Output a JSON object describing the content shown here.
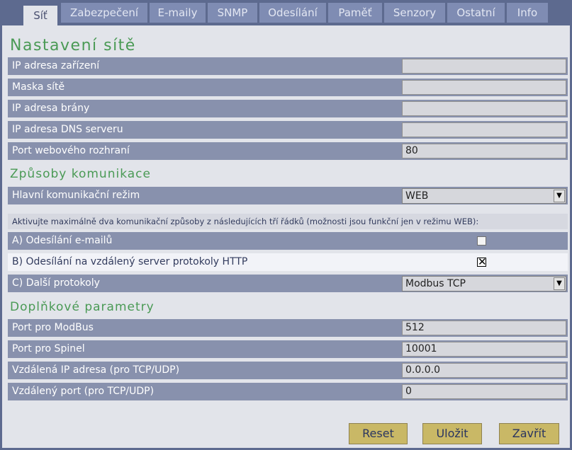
{
  "tabs": [
    "Síť",
    "Zabezpečení",
    "E-maily",
    "SNMP",
    "Odesílání",
    "Paměť",
    "Senzory",
    "Ostatní",
    "Info"
  ],
  "page_title": "Nastavení sítě",
  "network": {
    "ip_label": "IP adresa zařízení",
    "ip_value": "",
    "mask_label": "Maska sítě",
    "mask_value": "",
    "gateway_label": "IP adresa brány",
    "gateway_value": "",
    "dns_label": "IP adresa DNS serveru",
    "dns_value": "",
    "port_label": "Port webového rozhraní",
    "port_value": "80"
  },
  "communication": {
    "section_title": "Způsoby komunikace",
    "mode_label": "Hlavní komunikační režim",
    "mode_value": "WEB",
    "note": "Aktivujte maximálně dva komunikační způsoby z následujících tří řádků (možnosti jsou funkční jen v režimu WEB):",
    "email_label": "A) Odesílání e-mailů",
    "email_checked": false,
    "http_label": "B) Odesílání na vzdálený server protokoly HTTP",
    "http_checked": true,
    "http_mark": "✕",
    "other_label": "C) Další protokoly",
    "other_value": "Modbus TCP"
  },
  "additional": {
    "section_title": "Doplňkové parametry",
    "modbus_label": "Port pro ModBus",
    "modbus_value": "512",
    "spinel_label": "Port pro Spinel",
    "spinel_value": "10001",
    "remote_ip_label": "Vzdálená IP adresa (pro TCP/UDP)",
    "remote_ip_value": "0.0.0.0",
    "remote_port_label": "Vzdálený port (pro TCP/UDP)",
    "remote_port_value": "0"
  },
  "buttons": {
    "reset": "Reset",
    "save": "Uložit",
    "close": "Zavřít"
  },
  "icons": {
    "select_arrow": "chevron-down-icon",
    "checkbox_mark": "close-icon"
  },
  "colors": {
    "accent_green": "#4a9a55",
    "tab_bg": "#7f8cb3",
    "row_bg": "#8891ad",
    "button_bg": "#c9b866"
  }
}
